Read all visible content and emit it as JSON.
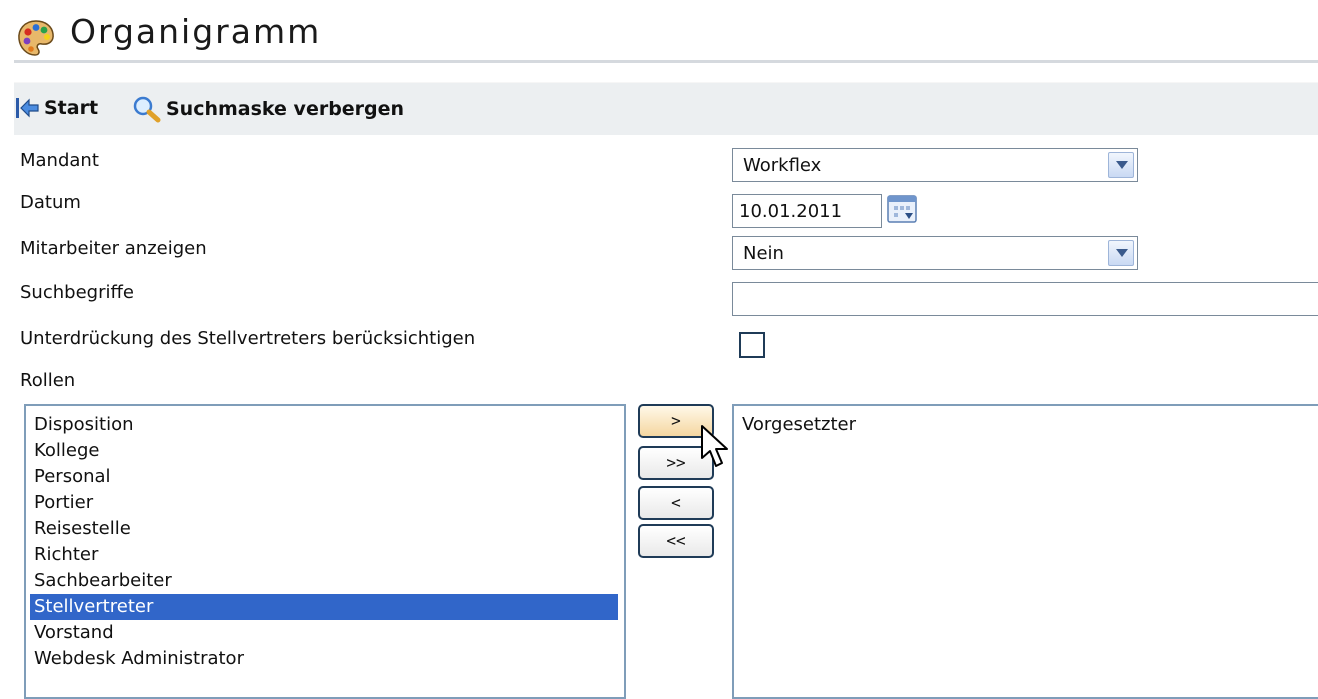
{
  "title": "Organigramm",
  "toolbar": {
    "start_label": "Start",
    "hide_label": "Suchmaske verbergen"
  },
  "form": {
    "mandant": {
      "label": "Mandant",
      "value": "Workflex"
    },
    "datum": {
      "label": "Datum",
      "value": "10.01.2011"
    },
    "mitarbeiter": {
      "label": "Mitarbeiter anzeigen",
      "value": "Nein"
    },
    "suchbegriffe": {
      "label": "Suchbegriffe",
      "value": ""
    },
    "unterdrueckung": {
      "label": "Unterdrückung des Stellvertreters berücksichtigen",
      "checked": false
    },
    "rollen": {
      "label": "Rollen"
    }
  },
  "roles_available": [
    "Disposition",
    "Kollege",
    "Personal",
    "Portier",
    "Reisestelle",
    "Richter",
    "Sachbearbeiter",
    "Stellvertreter",
    "Vorstand",
    "Webdesk Administrator"
  ],
  "selected_index": 7,
  "roles_assigned": [
    "Vorgesetzter"
  ],
  "move_buttons": {
    "add": ">",
    "add_all": ">>",
    "remove": "<",
    "remove_all": "<<"
  }
}
